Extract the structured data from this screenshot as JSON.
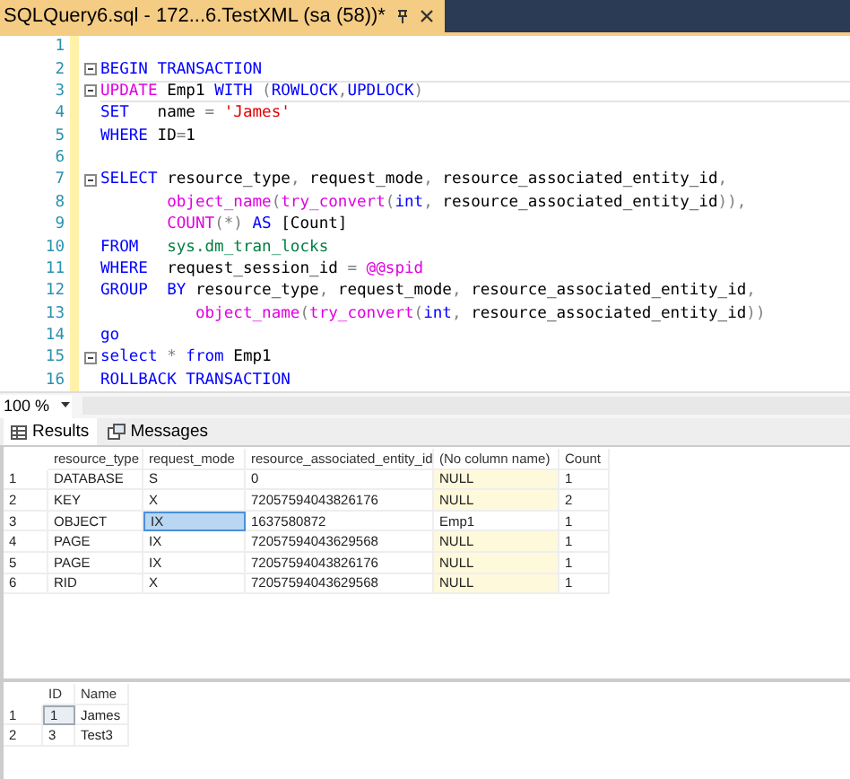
{
  "document_tab": {
    "title": "SQLQuery6.sql - 172...6.TestXML (sa (58))*",
    "selected": true
  },
  "editor": {
    "lines": [
      {
        "number": "1",
        "fold": false,
        "current": false
      },
      {
        "number": "2",
        "fold": true,
        "current": false,
        "tokens": [
          {
            "text": "BEGIN TRANSACTION",
            "kind": "keyword"
          }
        ]
      },
      {
        "number": "3",
        "fold": true,
        "current": true,
        "tokens": [
          {
            "text": "UPDATE",
            "kind": "function"
          },
          {
            "text": " Emp1 ",
            "kind": "plain"
          },
          {
            "text": "WITH",
            "kind": "keyword"
          },
          {
            "text": " (",
            "kind": "operator"
          },
          {
            "text": "ROWLOCK",
            "kind": "keyword"
          },
          {
            "text": ",",
            "kind": "operator"
          },
          {
            "text": "UPDLOCK",
            "kind": "keyword"
          },
          {
            "text": ")",
            "kind": "operator"
          }
        ]
      },
      {
        "number": "4",
        "fold": false,
        "current": false,
        "tokens": [
          {
            "text": "SET",
            "kind": "keyword"
          },
          {
            "text": "   name ",
            "kind": "plain"
          },
          {
            "text": "=",
            "kind": "operator"
          },
          {
            "text": " 'James'",
            "kind": "string"
          }
        ]
      },
      {
        "number": "5",
        "fold": false,
        "current": false,
        "tokens": [
          {
            "text": "WHERE",
            "kind": "keyword"
          },
          {
            "text": " ID",
            "kind": "plain"
          },
          {
            "text": "=",
            "kind": "operator"
          },
          {
            "text": "1",
            "kind": "plain"
          }
        ]
      },
      {
        "number": "6",
        "fold": false,
        "current": false
      },
      {
        "number": "7",
        "fold": true,
        "current": false,
        "tokens": [
          {
            "text": "SELECT",
            "kind": "keyword"
          },
          {
            "text": " resource_type",
            "kind": "plain"
          },
          {
            "text": ",",
            "kind": "operator"
          },
          {
            "text": " request_mode",
            "kind": "plain"
          },
          {
            "text": ",",
            "kind": "operator"
          },
          {
            "text": " resource_associated_entity_id",
            "kind": "plain"
          },
          {
            "text": ",",
            "kind": "operator"
          }
        ]
      },
      {
        "number": "8",
        "fold": false,
        "current": false,
        "tokens": [
          {
            "text": "       object_name",
            "kind": "function"
          },
          {
            "text": "(",
            "kind": "operator"
          },
          {
            "text": "try_convert",
            "kind": "function"
          },
          {
            "text": "(",
            "kind": "operator"
          },
          {
            "text": "int",
            "kind": "keyword"
          },
          {
            "text": ",",
            "kind": "operator"
          },
          {
            "text": " resource_associated_entity_id",
            "kind": "plain"
          },
          {
            "text": ")),",
            "kind": "operator"
          }
        ]
      },
      {
        "number": "9",
        "fold": false,
        "current": false,
        "tokens": [
          {
            "text": "       COUNT",
            "kind": "function"
          },
          {
            "text": "(*)",
            "kind": "operator"
          },
          {
            "text": " AS",
            "kind": "keyword"
          },
          {
            "text": " [Count]",
            "kind": "plain"
          }
        ]
      },
      {
        "number": "10",
        "fold": false,
        "current": false,
        "tokens": [
          {
            "text": "FROM",
            "kind": "keyword"
          },
          {
            "text": "   sys.dm_tran_locks",
            "kind": "system"
          }
        ]
      },
      {
        "number": "11",
        "fold": false,
        "current": false,
        "tokens": [
          {
            "text": "WHERE",
            "kind": "keyword"
          },
          {
            "text": "  request_session_id ",
            "kind": "plain"
          },
          {
            "text": "=",
            "kind": "operator"
          },
          {
            "text": " @@spid",
            "kind": "function"
          }
        ]
      },
      {
        "number": "12",
        "fold": false,
        "current": false,
        "tokens": [
          {
            "text": "GROUP",
            "kind": "keyword"
          },
          {
            "text": "  BY",
            "kind": "keyword"
          },
          {
            "text": " resource_type",
            "kind": "plain"
          },
          {
            "text": ",",
            "kind": "operator"
          },
          {
            "text": " request_mode",
            "kind": "plain"
          },
          {
            "text": ",",
            "kind": "operator"
          },
          {
            "text": " resource_associated_entity_id",
            "kind": "plain"
          },
          {
            "text": ",",
            "kind": "operator"
          }
        ]
      },
      {
        "number": "13",
        "fold": false,
        "current": false,
        "tokens": [
          {
            "text": "          object_name",
            "kind": "function"
          },
          {
            "text": "(",
            "kind": "operator"
          },
          {
            "text": "try_convert",
            "kind": "function"
          },
          {
            "text": "(",
            "kind": "operator"
          },
          {
            "text": "int",
            "kind": "keyword"
          },
          {
            "text": ",",
            "kind": "operator"
          },
          {
            "text": " resource_associated_entity_id",
            "kind": "plain"
          },
          {
            "text": "))",
            "kind": "operator"
          }
        ]
      },
      {
        "number": "14",
        "fold": false,
        "current": false,
        "tokens": [
          {
            "text": "go",
            "kind": "keyword"
          }
        ]
      },
      {
        "number": "15",
        "fold": true,
        "current": false,
        "tokens": [
          {
            "text": "select",
            "kind": "keyword"
          },
          {
            "text": " *",
            "kind": "operator"
          },
          {
            "text": " from",
            "kind": "keyword"
          },
          {
            "text": " Emp1",
            "kind": "plain"
          }
        ]
      },
      {
        "number": "16",
        "fold": false,
        "current": false,
        "tokens": [
          {
            "text": "ROLLBACK TRANSACTION",
            "kind": "keyword"
          }
        ]
      }
    ]
  },
  "zoom": {
    "value": "100 %"
  },
  "result_tabs": [
    {
      "label": "Results",
      "kind": "grid",
      "selected": true
    },
    {
      "label": "Messages",
      "kind": "messages",
      "selected": false
    }
  ],
  "grids": [
    {
      "columns": [
        "resource_type",
        "request_mode",
        "resource_associated_entity_id",
        "(No column name)",
        "Count"
      ],
      "rows": [
        {
          "number": "1",
          "cells": [
            {
              "text": "DATABASE",
              "kind": "value",
              "selected": false
            },
            {
              "text": "S",
              "kind": "value",
              "selected": false
            },
            {
              "text": "0",
              "kind": "value",
              "selected": false
            },
            {
              "text": "NULL",
              "kind": "null",
              "selected": false
            },
            {
              "text": "1",
              "kind": "value",
              "selected": false
            }
          ]
        },
        {
          "number": "2",
          "cells": [
            {
              "text": "KEY",
              "kind": "value",
              "selected": false
            },
            {
              "text": "X",
              "kind": "value",
              "selected": false
            },
            {
              "text": "72057594043826176",
              "kind": "value",
              "selected": false
            },
            {
              "text": "NULL",
              "kind": "null",
              "selected": false
            },
            {
              "text": "2",
              "kind": "value",
              "selected": false
            }
          ]
        },
        {
          "number": "3",
          "cells": [
            {
              "text": "OBJECT",
              "kind": "value",
              "selected": false
            },
            {
              "text": "IX",
              "kind": "value",
              "selected": true
            },
            {
              "text": "1637580872",
              "kind": "value",
              "selected": false
            },
            {
              "text": "Emp1",
              "kind": "value",
              "selected": false
            },
            {
              "text": "1",
              "kind": "value",
              "selected": false
            }
          ]
        },
        {
          "number": "4",
          "cells": [
            {
              "text": "PAGE",
              "kind": "value",
              "selected": false
            },
            {
              "text": "IX",
              "kind": "value",
              "selected": false
            },
            {
              "text": "72057594043629568",
              "kind": "value",
              "selected": false
            },
            {
              "text": "NULL",
              "kind": "null",
              "selected": false
            },
            {
              "text": "1",
              "kind": "value",
              "selected": false
            }
          ]
        },
        {
          "number": "5",
          "cells": [
            {
              "text": "PAGE",
              "kind": "value",
              "selected": false
            },
            {
              "text": "IX",
              "kind": "value",
              "selected": false
            },
            {
              "text": "72057594043826176",
              "kind": "value",
              "selected": false
            },
            {
              "text": "NULL",
              "kind": "null",
              "selected": false
            },
            {
              "text": "1",
              "kind": "value",
              "selected": false
            }
          ]
        },
        {
          "number": "6",
          "cells": [
            {
              "text": "RID",
              "kind": "value",
              "selected": false
            },
            {
              "text": "X",
              "kind": "value",
              "selected": false
            },
            {
              "text": "72057594043629568",
              "kind": "value",
              "selected": false
            },
            {
              "text": "NULL",
              "kind": "null",
              "selected": false
            },
            {
              "text": "1",
              "kind": "value",
              "selected": false
            }
          ]
        }
      ]
    },
    {
      "columns": [
        "ID",
        "Name"
      ],
      "rows": [
        {
          "number": "1",
          "cells": [
            {
              "text": "1",
              "kind": "value",
              "selected": true
            },
            {
              "text": "James",
              "kind": "value",
              "selected": false
            }
          ]
        },
        {
          "number": "2",
          "cells": [
            {
              "text": "3",
              "kind": "value",
              "selected": false
            },
            {
              "text": "Test3",
              "kind": "value",
              "selected": false
            }
          ]
        }
      ]
    }
  ]
}
